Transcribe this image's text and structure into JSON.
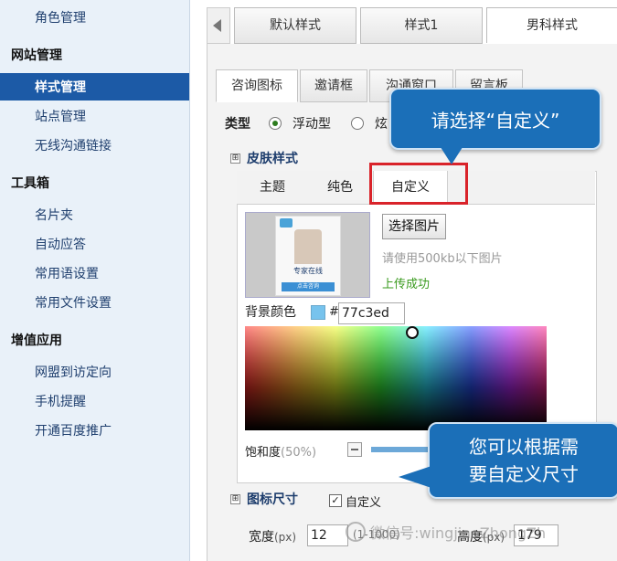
{
  "sidebar": {
    "items": [
      {
        "label": "角色管理"
      },
      {
        "label": "网站管理"
      },
      {
        "label": "样式管理"
      },
      {
        "label": "站点管理"
      },
      {
        "label": "无线沟通链接"
      },
      {
        "label": "工具箱"
      },
      {
        "label": "名片夹"
      },
      {
        "label": "自动应答"
      },
      {
        "label": "常用语设置"
      },
      {
        "label": "常用文件设置"
      },
      {
        "label": "增值应用"
      },
      {
        "label": "网盟到访定向"
      },
      {
        "label": "手机提醒"
      },
      {
        "label": "开通百度推广"
      }
    ]
  },
  "style_tabs": [
    {
      "label": "默认样式"
    },
    {
      "label": "样式1"
    },
    {
      "label": "男科样式"
    }
  ],
  "section_tabs": [
    {
      "label": "咨询图标"
    },
    {
      "label": "邀请框"
    },
    {
      "label": "沟通窗口"
    },
    {
      "label": "留言板"
    }
  ],
  "type_row": {
    "label": "类型",
    "options": [
      {
        "label": "浮动型"
      },
      {
        "label": "炫"
      }
    ]
  },
  "skin": {
    "title": "皮肤样式",
    "tabs": [
      {
        "label": "主题"
      },
      {
        "label": "纯色"
      },
      {
        "label": "自定义"
      }
    ],
    "choose_button": "选择图片",
    "hint": "请使用500kb以下图片",
    "upload_status": "上传成功",
    "bg_label": "背景颜色",
    "hash": "#",
    "color_value": "77c3ed",
    "saturation_label": "饱和度",
    "saturation_value": "(50%)",
    "thumb_caption": "专家在线",
    "thumb_sub": "点击咨询"
  },
  "icon_size": {
    "title": "图标尺寸",
    "custom_label": "自定义",
    "width_label": "宽度",
    "width_unit": "(px)",
    "width_value": "12",
    "range": "(1-1000)",
    "height_label": "高度",
    "height_unit": "(px)",
    "height_value": "179"
  },
  "callouts": {
    "top": "请选择“自定义”",
    "bottom_line1": "您可以根据需",
    "bottom_line2": "要自定义尺寸"
  },
  "watermark": "微信号:wingjiaoZhongZh",
  "colors": {
    "accent": "#1c5aa6",
    "callout": "#1b6fb8",
    "highlight": "#d9232a",
    "success": "#3a9b1e",
    "swatch": "#77c3ed"
  }
}
